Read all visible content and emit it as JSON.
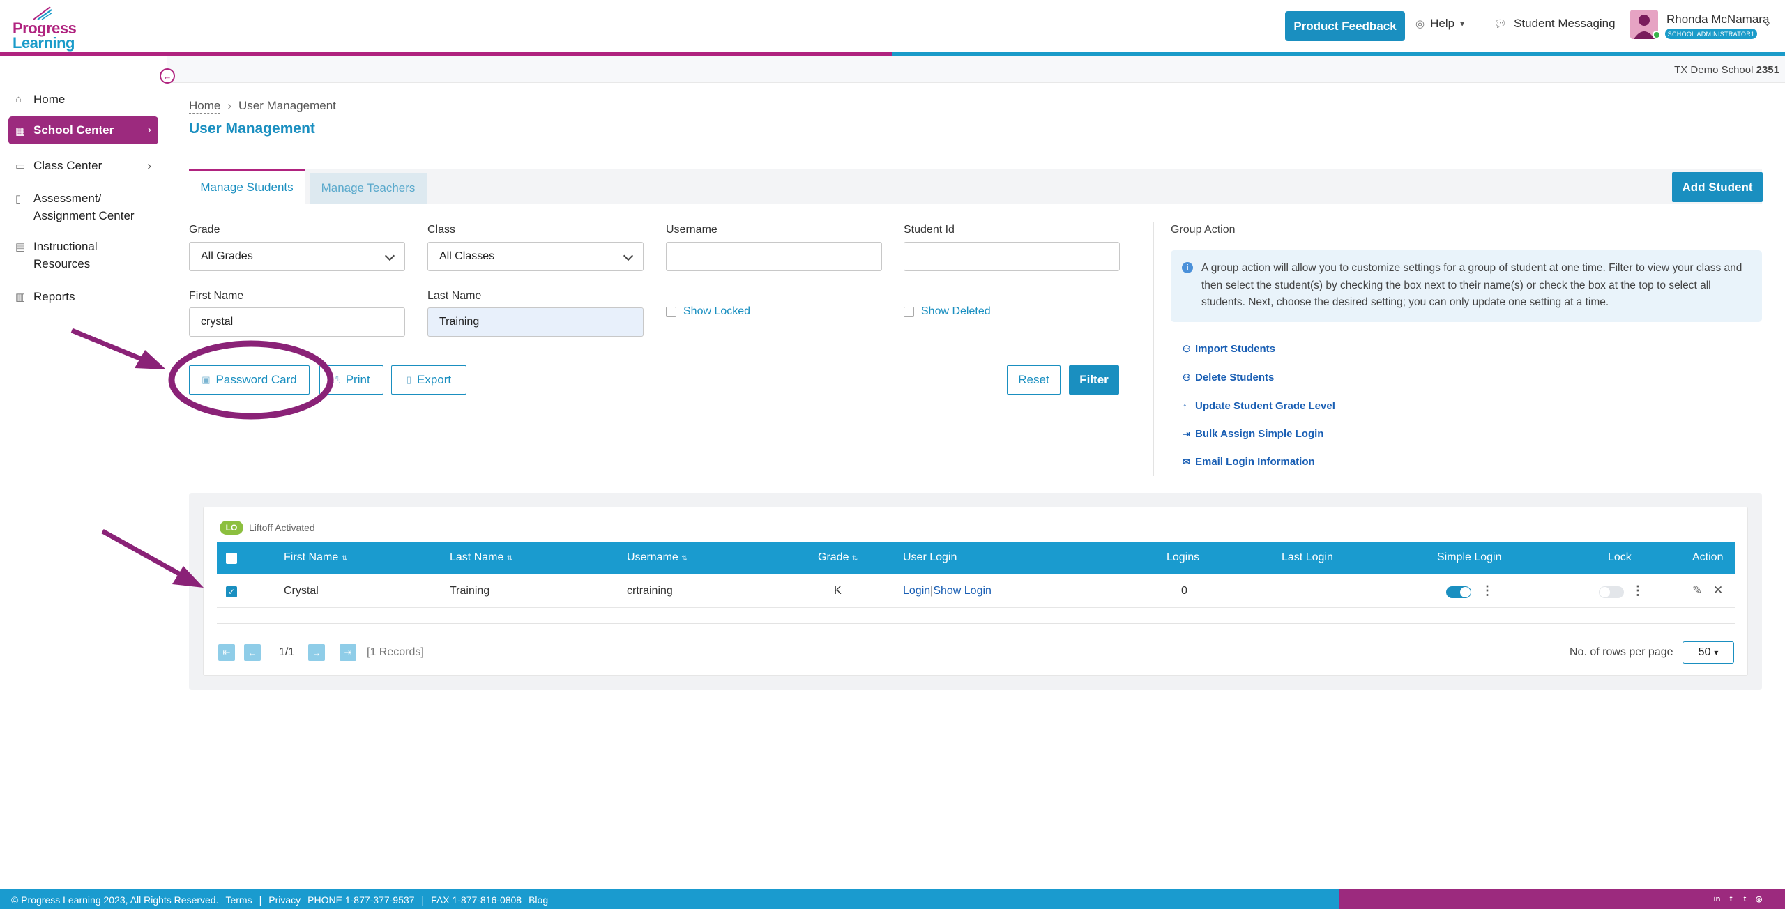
{
  "header": {
    "logo_line1": "Progress",
    "logo_line2": "Learning",
    "feedback_label": "Product Feedback",
    "help_label": "Help",
    "messaging_label": "Student Messaging",
    "user_name": "Rhonda McNamara",
    "user_role": "SCHOOL ADMINISTRATOR1"
  },
  "subheader": {
    "school_name": "TX Demo School",
    "school_id": "2351"
  },
  "sidebar": {
    "items": [
      {
        "label": "Home",
        "icon": "home-icon"
      },
      {
        "label": "School Center",
        "icon": "school-icon"
      },
      {
        "label": "Class Center",
        "icon": "class-icon"
      },
      {
        "label": "Assessment/",
        "label2": "Assignment Center",
        "icon": "book-icon"
      },
      {
        "label": "Instructional",
        "label2": "Resources",
        "icon": "resources-icon"
      },
      {
        "label": "Reports",
        "icon": "report-icon"
      }
    ]
  },
  "breadcrumb": {
    "home": "Home",
    "current": "User Management"
  },
  "page_title": "User Management",
  "tabs": [
    {
      "label": "Manage Students",
      "active": true
    },
    {
      "label": "Manage Teachers",
      "active": false
    }
  ],
  "add_student_label": "Add Student",
  "filters": {
    "grade_label": "Grade",
    "grade_value": "All Grades",
    "class_label": "Class",
    "class_value": "All Classes",
    "username_label": "Username",
    "username_value": "",
    "studentid_label": "Student Id",
    "studentid_value": "",
    "firstname_label": "First Name",
    "firstname_value": "crystal",
    "lastname_label": "Last Name",
    "lastname_value": "Training",
    "show_locked_label": "Show Locked",
    "show_deleted_label": "Show Deleted"
  },
  "actions": {
    "password_card": "Password Card",
    "print": "Print",
    "export": "Export",
    "reset": "Reset",
    "filter": "Filter"
  },
  "group_action": {
    "title": "Group Action",
    "info": "A group action will allow you to customize settings for a group of student at one time. Filter to view your class and then select the student(s) by checking the box next to their name(s) or check the box at the top to select all students. Next, choose the desired setting; you can only update one setting at a time.",
    "links": [
      {
        "label": "Import Students",
        "icon": "user-import-icon"
      },
      {
        "label": "Delete Students",
        "icon": "user-delete-icon"
      },
      {
        "label": "Update Student Grade Level",
        "icon": "arrow-up-icon"
      },
      {
        "label": "Bulk Assign Simple Login",
        "icon": "login-icon"
      },
      {
        "label": "Email Login Information",
        "icon": "mail-icon"
      }
    ]
  },
  "table": {
    "badge": "LO",
    "badge_label": "Liftoff Activated",
    "columns": [
      "First Name",
      "Last Name",
      "Username",
      "Grade",
      "User Login",
      "Logins",
      "Last Login",
      "Simple Login",
      "Lock",
      "Action"
    ],
    "rows": [
      {
        "first_name": "Crystal",
        "last_name": "Training",
        "username": "crtraining",
        "grade": "K",
        "login_link": "Login",
        "show_login_link": "Show Login",
        "logins": "0",
        "last_login": "",
        "simple_login": true,
        "lock": false,
        "selected": true
      }
    ]
  },
  "pagination": {
    "page": "1/1",
    "records": "[1 Records]",
    "rows_per_page_label": "No. of rows per page",
    "rows_per_page": "50"
  },
  "footer": {
    "copyright": "© Progress Learning 2023, All Rights Reserved.",
    "terms": "Terms",
    "privacy": "Privacy",
    "phone": "PHONE 1-877-377-9537",
    "fax": "FAX 1-877-816-0808",
    "blog": "Blog",
    "sep": "|"
  },
  "colors": {
    "brand_magenta": "#b0237f",
    "brand_blue": "#1a9bc9",
    "annotation": "#8a2277"
  }
}
